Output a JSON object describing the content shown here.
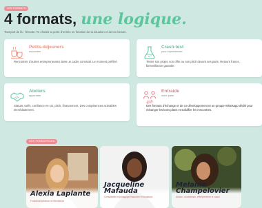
{
  "header": {
    "tag": "LES FORMATS",
    "title_main": "4 formats,",
    "title_accent": "une logique.",
    "intro": "Tout part de là : l'écoute. Tu choisis ta porte d'entrée en fonction de ta situation et de ton besoin."
  },
  "formats": [
    {
      "title": "Petits-déjeuners",
      "subtitle": "rencontrer",
      "description": "Rencontrer d'autres entrepreneuses dans un cadre convivial. Le moment préféré.",
      "icon": "coffee-cups-icon",
      "color": "#f08f7a"
    },
    {
      "title": "Crash-test",
      "subtitle": "pour expérimenter",
      "description": "Tester son projet, son offre ou son pitch devant ses pairs. Retours francs, bienveillance garantie.",
      "icon": "flask-icon",
      "color": "#5cc59c"
    },
    {
      "title": "Ateliers",
      "subtitle": "apprendre",
      "description": "Statuts, tarifs, confiance en soi, pitch, financement. Des compétences activables immédiatement.",
      "icon": "handshake-icon",
      "color": "#5cc59c"
    },
    {
      "title": "Entraide",
      "subtitle": "entre pairs",
      "description": "Des formats d'échange et de co-développement et un groupe Whatsapp dédié pour échanger les bons plans et solidifier les rencontres.",
      "icon": "people-exchange-icon",
      "color": "#ee7c86"
    }
  ],
  "team": {
    "tag": "NOS FONDATRICES",
    "members": [
      {
        "name": "Alexia Laplante",
        "role": "Fondatrice/créatrice de Bienfaitrice"
      },
      {
        "name": "Jacqueline Mafauda",
        "role": "Consultante en pédagogie financière et fondatrice"
      },
      {
        "name": "Melanie Champelovier",
        "role": "Autrice, comédienne, entrepreneure et coach"
      }
    ]
  }
}
